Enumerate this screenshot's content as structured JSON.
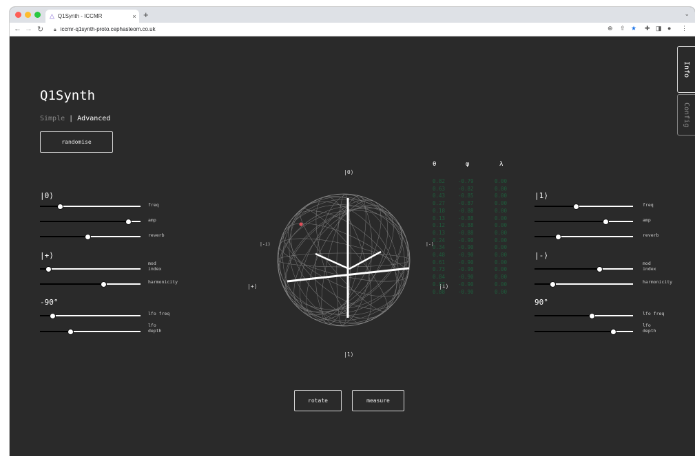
{
  "browser": {
    "tab_title": "Q1Synth - ICCMR",
    "tab_close": "×",
    "new_tab": "+",
    "url": "iccmr-q1synth-proto.cephasteom.co.uk"
  },
  "app": {
    "title": "Q1Synth",
    "mode_simple": "Simple",
    "mode_separator": "|",
    "mode_advanced": "Advanced",
    "randomise": "randomise",
    "rotate": "rotate",
    "measure": "measure"
  },
  "side_tabs": {
    "info": "Info",
    "config": "Config"
  },
  "left_panel": {
    "state0_label": "|0⟩",
    "statePlus_label": "|+⟩",
    "angle_label": "-90°",
    "freq": "freq",
    "amp": "amp",
    "reverb": "reverb",
    "mod_index": "mod\nindex",
    "harmonicity": "harmonicity",
    "lfo_freq": "lfo freq",
    "lfo_depth": "lfo\ndepth"
  },
  "right_panel": {
    "state1_label": "|1⟩",
    "stateMinus_label": "|-⟩",
    "angle_label": "90°",
    "freq": "freq",
    "amp": "amp",
    "reverb": "reverb",
    "mod_index": "mod\nindex",
    "harmonicity": "harmonicity",
    "lfo_freq": "lfo freq",
    "lfo_depth": "lfo\ndepth"
  },
  "sliders": {
    "left": {
      "freq": 0.2,
      "amp": 0.88,
      "reverb": 0.47,
      "mod_index": 0.08,
      "harmonicity": 0.63,
      "lfo_freq": 0.12,
      "lfo_depth": 0.3
    },
    "right": {
      "freq": 0.42,
      "amp": 0.72,
      "reverb": 0.24,
      "mod_index": 0.66,
      "harmonicity": 0.18,
      "lfo_freq": 0.58,
      "lfo_depth": 0.8
    }
  },
  "bloch": {
    "top": "|0⟩",
    "bottom": "|1⟩",
    "left_minus_i": "|-i⟩",
    "left_plus": "|+⟩",
    "right_minus": "|-⟩",
    "right_i": "|i⟩"
  },
  "table": {
    "theta_header": "θ",
    "phi_header": "φ",
    "lambda_header": "λ",
    "theta": [
      "0.82",
      "0.63",
      "0.43",
      "0.27",
      "0.18",
      "0.13",
      "0.12",
      "0.13",
      "0.24",
      "0.34",
      "0.48",
      "0.61",
      "0.73",
      "0.84",
      "0.87",
      "0.88"
    ],
    "phi": [
      "-0.79",
      "-0.82",
      "-0.85",
      "-0.87",
      "-0.88",
      "-0.88",
      "-0.88",
      "-0.88",
      "-0.90",
      "-0.90",
      "-0.90",
      "-0.90",
      "-0.90",
      "-0.90",
      "-0.90",
      "-0.90"
    ],
    "lambda": [
      "0.00",
      "0.00",
      "0.00",
      "0.00",
      "0.00",
      "0.00",
      "0.00",
      "0.00",
      "0.00",
      "0.00",
      "0.00",
      "0.00",
      "0.00",
      "0.00",
      "0.00",
      "0.00"
    ]
  },
  "colors": {
    "background": "#2a2a2a",
    "table_text": "#1f5c3c",
    "marker": "#e0505a"
  }
}
